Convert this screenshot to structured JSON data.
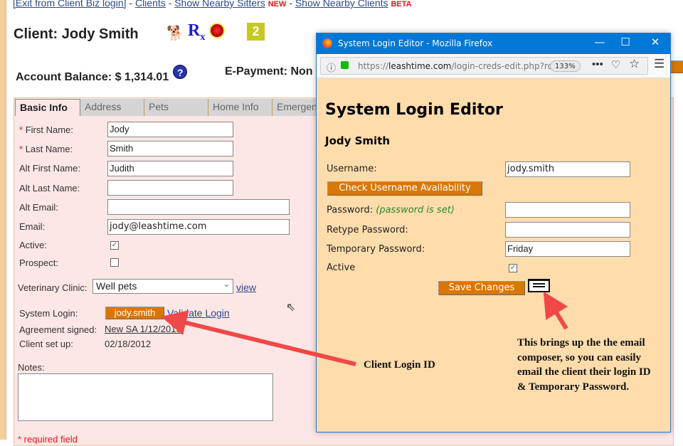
{
  "top_links": {
    "exit": "[Exit from Client Biz login]",
    "sep": " - ",
    "clients": "Clients",
    "sitters": "Show Nearby Sitters",
    "new_badge": "NEW",
    "nearby_clients": "Show Nearby Clients",
    "beta_badge": "BETA"
  },
  "header": {
    "title": "Client: Jody Smith",
    "icons": [
      "running-dog-icon",
      "rx-icon",
      "alarm-light-icon"
    ],
    "badge": "2",
    "account_balance": "Account Balance: $ 1,314.01",
    "help_icon": "?",
    "epayment": "E-Payment: Non"
  },
  "tabs": [
    "Basic Info",
    "Address",
    "Pets",
    "Home Info",
    "Emergen"
  ],
  "form": {
    "first_name": {
      "label": "First Name:",
      "value": "Jody",
      "required": "*"
    },
    "last_name": {
      "label": "Last Name:",
      "value": "Smith",
      "required": "*"
    },
    "alt_first_name": {
      "label": "Alt First Name:",
      "value": "Judith"
    },
    "alt_last_name": {
      "label": "Alt Last Name:",
      "value": ""
    },
    "alt_email": {
      "label": "Alt Email:",
      "value": ""
    },
    "email": {
      "label": "Email:",
      "value": "jody@leashtime.com"
    },
    "active": {
      "label": "Active:",
      "checked": true
    },
    "prospect": {
      "label": "Prospect:",
      "checked": false
    },
    "vet": {
      "label": "Veterinary Clinic:",
      "value": "Well pets",
      "view": "view"
    },
    "system_login": {
      "label": "System Login:",
      "value": "jody.smith",
      "validate": "Validate Login"
    },
    "agreement": {
      "label": "Agreement signed:",
      "value": "New SA 1/12/2015"
    },
    "setup": {
      "label": "Client set up:",
      "value": "02/18/2012"
    },
    "notes": {
      "label": "Notes:",
      "value": ""
    },
    "required_note": "* required field"
  },
  "popup": {
    "window_title": "System Login Editor - Mozilla Firefox",
    "url_prefix": "https://",
    "url_domain": "leashtime.com",
    "url_path": "/login-creds-edit.php?ro",
    "zoom": "133%",
    "heading": "System Login Editor",
    "client_name": "Jody Smith",
    "username": {
      "label": "Username:",
      "value": "jody.smith"
    },
    "check_button": "Check Username Availability",
    "password": {
      "label": "Password:",
      "note": "(password is set)",
      "value": ""
    },
    "retype": {
      "label": "Retype Password:",
      "value": ""
    },
    "temp": {
      "label": "Temporary Password:",
      "value": "Friday"
    },
    "active": {
      "label": "Active",
      "checked": true
    },
    "save_button": "Save Changes"
  },
  "annotations": {
    "login_id": "Client Login ID",
    "email_note": "This brings up the the email composer, so you can easily email the client their login ID & Temporary Password.",
    "arrow_color": "#f04848"
  },
  "colors": {
    "accent": "#d97706",
    "panel": "#fde6e6",
    "popup_bg": "#fedcac",
    "titlebar": "#0078d7"
  }
}
